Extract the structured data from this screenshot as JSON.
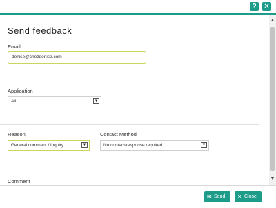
{
  "header": {
    "help_glyph": "?",
    "close_glyph": "✕"
  },
  "form": {
    "title": "Send  feedback",
    "email": {
      "label": "Email",
      "value": "denise@chezdenise.com"
    },
    "application": {
      "label": "Application",
      "selected": "All"
    },
    "reason": {
      "label": "Reason",
      "selected": "General comment / inquiry"
    },
    "contact_method": {
      "label": "Contact  Method",
      "selected": "No contact/response required"
    },
    "comment": {
      "label": "Comment"
    }
  },
  "footer": {
    "send_label": "Send",
    "close_label": "Close"
  },
  "icons": {
    "send": "send-icon",
    "close": "close-icon",
    "help": "help-icon",
    "dropdown": "chevron-down-icon"
  },
  "colors": {
    "accent": "#1e9c8a",
    "focus_border": "#c9d65a"
  }
}
